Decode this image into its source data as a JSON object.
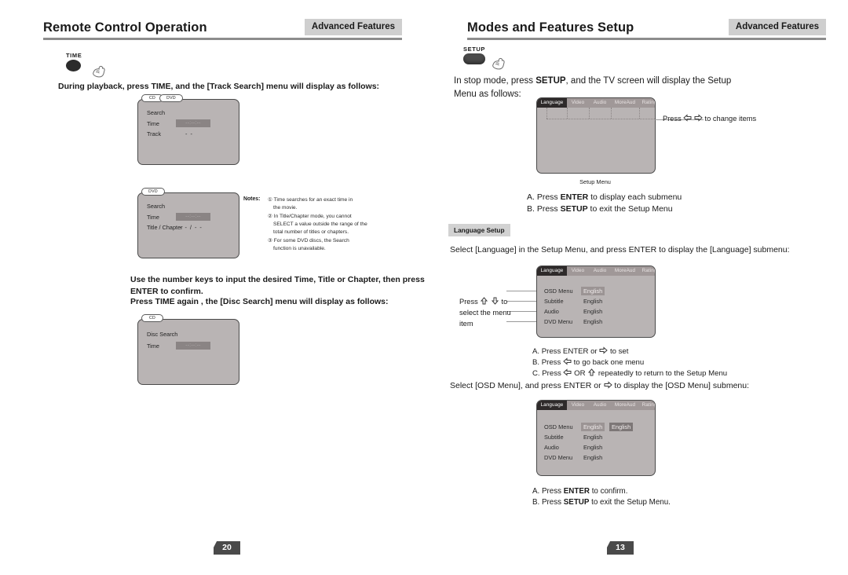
{
  "left_page": {
    "header": {
      "title": "Remote Control Operation",
      "badge": "Advanced Features"
    },
    "key": {
      "label": "TIME"
    },
    "intro": "During playback, press  TIME, and the [Track Search] menu will display as follows:",
    "screen_track_search": {
      "tabs": [
        "CD",
        "DVD"
      ],
      "rows": [
        {
          "label": "Search",
          "value": ""
        },
        {
          "label": "Time",
          "value": "--:--:--",
          "highlight": true
        },
        {
          "label": "Track",
          "value": "- -"
        }
      ]
    },
    "screen_dvd_search": {
      "tabs": [
        "DVD"
      ],
      "rows": [
        {
          "label": "Search",
          "value": ""
        },
        {
          "label": "Time",
          "value": "--:--:--",
          "highlight": true
        },
        {
          "label": "Title / Chapter",
          "value": "- - / - -"
        }
      ]
    },
    "notes": {
      "label": "Notes:",
      "items": [
        "① Time searches for an exact time in",
        "the movie.",
        "② In Title/Chapter mode, you cannot",
        "SELECT a value outside the range of the",
        "total number of titles or chapters.",
        "③ For some DVD discs, the Search",
        "function is unavailable."
      ]
    },
    "instruction_1": "Use the number keys to input  the desired Time, Title or Chapter, then press ENTER to confirm.",
    "instruction_2": "Press  TIME again , the [Disc Search] menu will display as follows:",
    "screen_disc_search": {
      "tabs": [
        "CD"
      ],
      "rows": [
        {
          "label": "Disc Search",
          "value": ""
        },
        {
          "label": "Time",
          "value": "--:--:--",
          "highlight": true
        }
      ]
    },
    "page_number": "20"
  },
  "right_page": {
    "header": {
      "title": "Modes and Features Setup",
      "badge": "Advanced Features"
    },
    "key": {
      "label": "SETUP"
    },
    "intro_line1_a": "In stop mode, press ",
    "intro_line1_b": "SETUP",
    "intro_line1_c": ", and the TV screen will display the Setup",
    "intro_line2": "Menu as follows:",
    "setup_menu": {
      "tabs": [
        "Language",
        "Video",
        "Audio",
        "MoreAud",
        "Rating"
      ],
      "selected_tab": "Language",
      "caption": "Setup Menu",
      "callout": "to change items",
      "callout_prefix": "Press"
    },
    "setup_steps": [
      {
        "prefix": "A. Press ",
        "key": "ENTER",
        "suffix": " to display each submenu"
      },
      {
        "prefix": "B. Press ",
        "key": "SETUP",
        "suffix": " to exit the Setup Menu"
      }
    ],
    "language_setup": {
      "badge": "Language Setup",
      "intro": "Select [Language] in the Setup Menu, and press ENTER to display the [Language] submenu:",
      "submenu": {
        "tabs": [
          "Language",
          "Video",
          "Audio",
          "MoreAud",
          "Rating"
        ],
        "selected_tab": "Language",
        "rows": [
          {
            "label": "OSD Menu",
            "value": "English",
            "highlight": true
          },
          {
            "label": "Subtitle",
            "value": "English",
            "highlight": false
          },
          {
            "label": "Audio",
            "value": "English",
            "highlight": false
          },
          {
            "label": "DVD Menu",
            "value": "English",
            "highlight": false
          }
        ]
      },
      "side_callout": {
        "line1_prefix": "Press",
        "line1_suffix": "to",
        "line2": "select the menu",
        "line3": "item"
      },
      "steps": [
        {
          "text_a": "A.  Press ENTER or ",
          "text_b": "to set"
        },
        {
          "text_a": "B.  Press ",
          "text_b": "to go back one menu"
        },
        {
          "text_a": "C.  Press ",
          "text_mid": "OR",
          "text_b": "repeatedly to return to the Setup Menu"
        }
      ]
    },
    "osd_menu": {
      "intro_a": "Select [OSD Menu], and press ENTER or ",
      "intro_b": " to display the [OSD Menu] submenu:",
      "submenu": {
        "tabs": [
          "Language",
          "Video",
          "Audio",
          "MoreAud",
          "Rating"
        ],
        "selected_tab": "Language",
        "rows": [
          {
            "label": "OSD Menu",
            "value": "English",
            "value2": "English",
            "highlight": true
          },
          {
            "label": "Subtitle",
            "value": "English",
            "highlight": false
          },
          {
            "label": "Audio",
            "value": "English",
            "highlight": false
          },
          {
            "label": "DVD Menu",
            "value": "English",
            "highlight": false
          }
        ]
      },
      "steps": [
        {
          "prefix": "A.  Press ",
          "key": "ENTER",
          "suffix": " to confirm."
        },
        {
          "prefix": "B.  Press ",
          "key": "SETUP",
          "suffix": " to exit the Setup Menu."
        }
      ]
    },
    "page_number": "13"
  },
  "colors": {
    "screen_bg": "#b9b4b4",
    "screen_border": "#4a4a4a",
    "menubar": "#a09898",
    "tab_selected": "#2e2a2a",
    "badge_bg": "#cfcfcf",
    "rule": "#8d8d8d",
    "page_tag": "#4a4a4a"
  }
}
